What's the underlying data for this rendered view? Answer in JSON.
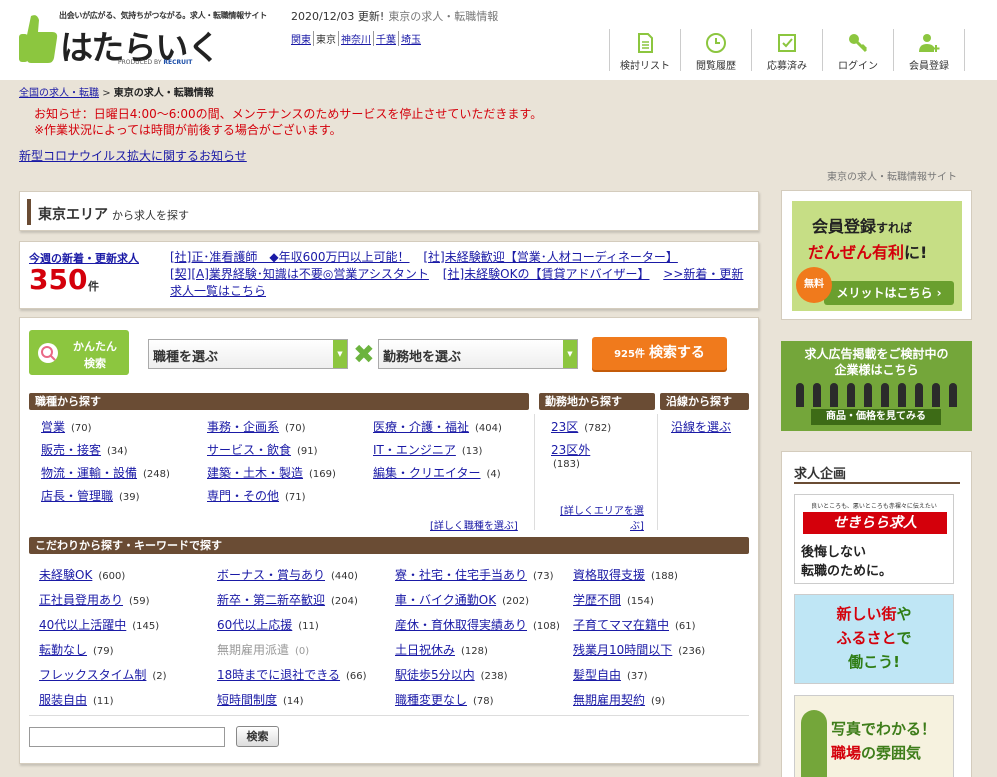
{
  "header": {
    "tagline": "出会いが広がる、気持ちがつながる。求人・転職情報サイト",
    "logo_text": "はたらいく",
    "logo_sub_prefix": "PRODUCED BY",
    "logo_sub_brand": "RECRUIT",
    "update_date": "2020/12/03 更新!",
    "update_sub": "東京の求人・転職情報",
    "regions": [
      "関東",
      "東京",
      "神奈川",
      "千葉",
      "埼玉"
    ],
    "nav": [
      {
        "label": "検討リスト",
        "icon": "document-icon"
      },
      {
        "label": "閲覧履歴",
        "icon": "clock-icon"
      },
      {
        "label": "応募済み",
        "icon": "check-icon"
      },
      {
        "label": "ログイン",
        "icon": "key-icon"
      },
      {
        "label": "会員登録",
        "icon": "user-add-icon"
      }
    ]
  },
  "breadcrumb": {
    "root": "全国の求人・転職",
    "sep": ">",
    "current": "東京の求人・転職情報"
  },
  "notice": {
    "line1": "お知らせ：日曜日4:00～6:00の間、メンテナンスのためサービスを停止させていただきます。",
    "line2": "※作業状況によっては時間が前後する場合がございます。",
    "covid_link": "新型コロナウイルス拡大に関するお知らせ",
    "site_tag": "東京の求人・転職情報サイト"
  },
  "area": {
    "title": "東京エリア",
    "suffix": "から求人を探す"
  },
  "new_jobs": {
    "label": "今週の新着・更新求人",
    "count": "350",
    "unit": "件",
    "links": [
      "[社]正･准看護師　◆年収600万円以上可能！",
      "[社]未経験歓迎【営業･人材コーディネーター】",
      "[契][A]業界経験･知識は不要◎営業アシスタント",
      "[社]未経験OKの【賃貸アドバイザー】",
      ">>新着・更新求人一覧はこちら"
    ]
  },
  "search": {
    "easy_line1": "かんたん",
    "easy_line2": "検索",
    "job_select": "職種を選ぶ",
    "loc_select": "勤務地を選ぶ",
    "button_count": "925件",
    "button_label": "検索する",
    "job_header": "職種から探す",
    "loc_header": "勤務地から探す",
    "line_header": "沿線から探す",
    "kw_header": "こだわりから探す・キーワードで探す",
    "jobs": [
      {
        "label": "営業",
        "count": "(70)"
      },
      {
        "label": "事務・企画系",
        "count": "(70)"
      },
      {
        "label": "医療・介護・福祉",
        "count": "(404)"
      },
      {
        "label": "販売・接客",
        "count": "(34)"
      },
      {
        "label": "サービス・飲食",
        "count": "(91)"
      },
      {
        "label": "IT・エンジニア",
        "count": "(13)"
      },
      {
        "label": "物流・運輸・設備",
        "count": "(248)"
      },
      {
        "label": "建築・土木・製造",
        "count": "(169)"
      },
      {
        "label": "編集・クリエイター",
        "count": "(4)"
      },
      {
        "label": "店長・管理職",
        "count": "(39)"
      },
      {
        "label": "専門・その他",
        "count": "(71)"
      }
    ],
    "jobs_more": "[詳しく職種を選ぶ]",
    "locations": [
      {
        "label": "23区",
        "count": "(782)"
      },
      {
        "label": "23区外",
        "count": "(183)"
      }
    ],
    "loc_more_1": "[詳しくエリアを選",
    "loc_more_2": "ぶ]",
    "line_link": "沿線を選ぶ",
    "keywords": [
      {
        "label": "未経験OK",
        "count": "(600)"
      },
      {
        "label": "ボーナス・賞与あり",
        "count": "(440)"
      },
      {
        "label": "寮・社宅・住宅手当あり",
        "count": "(73)"
      },
      {
        "label": "資格取得支援",
        "count": "(188)"
      },
      {
        "label": "正社員登用あり",
        "count": "(59)"
      },
      {
        "label": "新卒・第二新卒歓迎",
        "count": "(204)"
      },
      {
        "label": "車・バイク通勤OK",
        "count": "(202)"
      },
      {
        "label": "学歴不問",
        "count": "(154)"
      },
      {
        "label": "40代以上活躍中",
        "count": "(145)"
      },
      {
        "label": "60代以上応援",
        "count": "(11)"
      },
      {
        "label": "産休・育休取得実績あり",
        "count": "(108)"
      },
      {
        "label": "子育てママ在籍中",
        "count": "(61)"
      },
      {
        "label": "転勤なし",
        "count": "(79)"
      },
      {
        "label": "無期雇用派遣",
        "count": "(0)",
        "disabled": true
      },
      {
        "label": "土日祝休み",
        "count": "(128)"
      },
      {
        "label": "残業月10時間以下",
        "count": "(236)"
      },
      {
        "label": "フレックスタイム制",
        "count": "(2)"
      },
      {
        "label": "18時までに退社できる",
        "count": "(66)"
      },
      {
        "label": "駅徒歩5分以内",
        "count": "(238)"
      },
      {
        "label": "髪型自由",
        "count": "(37)"
      },
      {
        "label": "服装自由",
        "count": "(11)"
      },
      {
        "label": "短時間制度",
        "count": "(14)"
      },
      {
        "label": "職種変更なし",
        "count": "(78)"
      },
      {
        "label": "無期雇用契約",
        "count": "(9)"
      }
    ],
    "kw_button": "検索"
  },
  "sidebar": {
    "ad1_l1a": "会員登録",
    "ad1_l1b": "すれば",
    "ad1_l2a": "だんぜん有利",
    "ad1_l2b": "に!",
    "ad1_badge": "無料",
    "ad1_btn": "メリットはこちら ›",
    "ad2_l1": "求人広告掲載をご検討中の",
    "ad2_l2": "企業様はこちら",
    "ad2_btn": "商品・価格を見てみる",
    "plan_title": "求人企画",
    "bn1_small": "良いところも、悪いところも赤裸々に伝えたい",
    "bn1_red": "せきらら求人",
    "bn1_l1": "後悔しない",
    "bn1_l2": "転職のために。",
    "bn2_l1a": "新しい街",
    "bn2_l1b": "や",
    "bn2_l2a": "ふるさと",
    "bn2_l2b": "で",
    "bn2_l3": "働こう!",
    "bn3_l1": "写真でわかる！",
    "bn3_l2a": "職場",
    "bn3_l2b": "の雰囲気"
  },
  "colors": {
    "accent_brown": "#6a4c34",
    "accent_green": "#8cc63f",
    "accent_orange": "#f07a1c",
    "link": "#1a1aa6",
    "alert_red": "#d4000b"
  }
}
